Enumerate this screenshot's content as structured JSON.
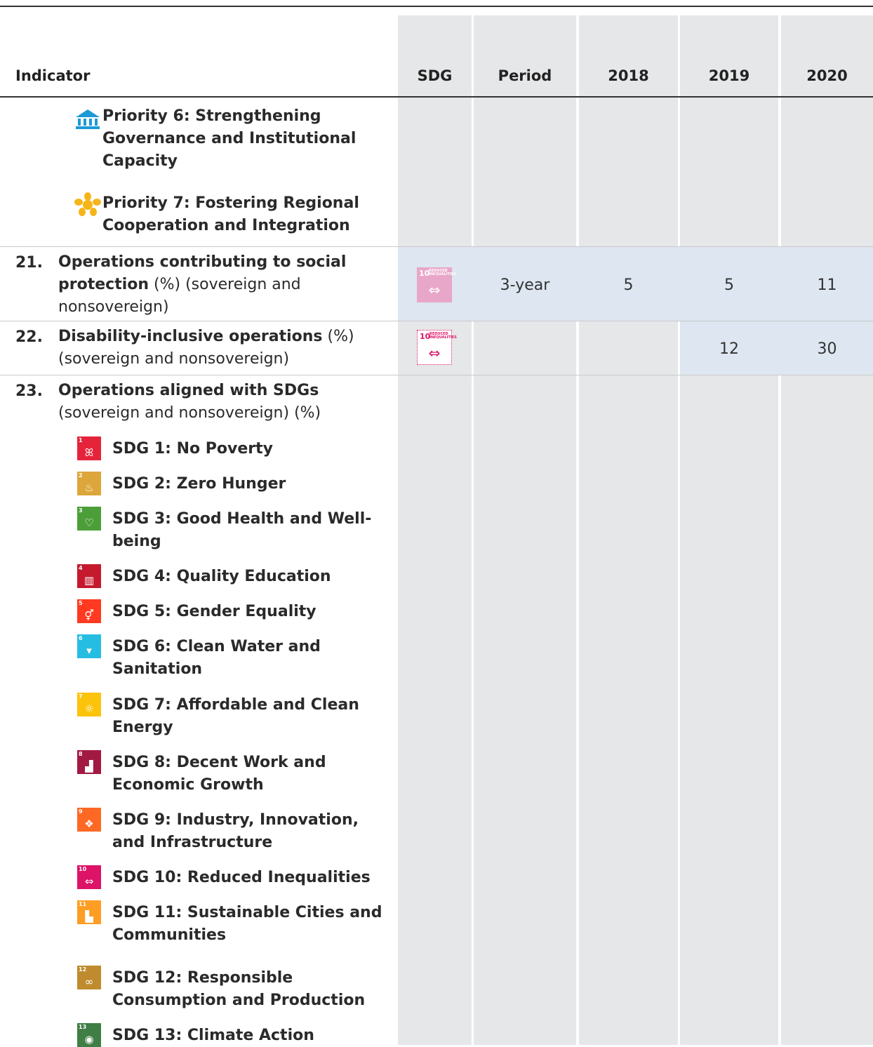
{
  "header": {
    "indicator": "Indicator",
    "sdg": "SDG",
    "period": "Period",
    "y2018": "2018",
    "y2019": "2019",
    "y2020": "2020"
  },
  "priorities": [
    {
      "label": "Priority 6: Strengthening Governance and Institutional Capacity",
      "icon": "bank-building-icon",
      "color": "#1d9ad6"
    },
    {
      "label": "Priority 7: Fostering Regional Cooperation and Integration",
      "icon": "cooperation-star-icon",
      "color": "#f5b51a"
    }
  ],
  "rows": [
    {
      "num": "21.",
      "bold": "Operations contributing to social protection",
      "rest": " (%) (sovereign and nonsovereign)",
      "sdg_badge": "10",
      "sdg_badge_text": "REDUCED INEQUALITIES",
      "period": "3-year",
      "v2018": "5",
      "v2019": "5",
      "v2020": "11"
    },
    {
      "num": "22.",
      "bold": "Disability-inclusive operations",
      "rest": " (%) (sovereign and nonsovereign)",
      "sdg_badge": "10",
      "sdg_badge_text": "REDUCED INEQUALITIES",
      "period": "",
      "v2018": "",
      "v2019": "12",
      "v2020": "30"
    },
    {
      "num": "23.",
      "bold": "Operations aligned with SDGs",
      "rest": " (sovereign and nonsovereign) (%)"
    }
  ],
  "sdgs": [
    {
      "n": "1",
      "label": "SDG 1: No Poverty",
      "color": "#e5243b",
      "glyph": "ꕤ"
    },
    {
      "n": "2",
      "label": "SDG 2: Zero Hunger",
      "color": "#dda63a",
      "glyph": "♨"
    },
    {
      "n": "3",
      "label": "SDG 3: Good Health and Well-being",
      "color": "#4c9f38",
      "glyph": "♡"
    },
    {
      "n": "4",
      "label": "SDG 4: Quality Education",
      "color": "#c5192d",
      "glyph": "▥"
    },
    {
      "n": "5",
      "label": "SDG 5: Gender Equality",
      "color": "#ff3a21",
      "glyph": "⚥"
    },
    {
      "n": "6",
      "label": "SDG 6: Clean Water and Sanitation",
      "color": "#26bde2",
      "glyph": "▾"
    },
    {
      "n": "7",
      "label": "SDG 7: Affordable and Clean Energy",
      "color": "#fcc30b",
      "glyph": "☼"
    },
    {
      "n": "8",
      "label": "SDG 8: Decent Work and Economic Growth",
      "color": "#a21942",
      "glyph": "▟"
    },
    {
      "n": "9",
      "label": "SDG 9: Industry, Innovation, and Infrastructure",
      "color": "#fd6925",
      "glyph": "❖"
    },
    {
      "n": "10",
      "label": "SDG 10: Reduced Inequalities",
      "color": "#dd1367",
      "glyph": "⇔"
    },
    {
      "n": "11",
      "label": "SDG 11: Sustainable Cities and Communities",
      "color": "#fd9d24",
      "glyph": "▙"
    },
    {
      "n": "12",
      "label": "SDG 12: Responsible Consumption and Production",
      "color": "#bf8b2e",
      "glyph": "∞"
    },
    {
      "n": "13",
      "label": "SDG 13: Climate Action",
      "color": "#3f7e44",
      "glyph": "◉"
    }
  ]
}
